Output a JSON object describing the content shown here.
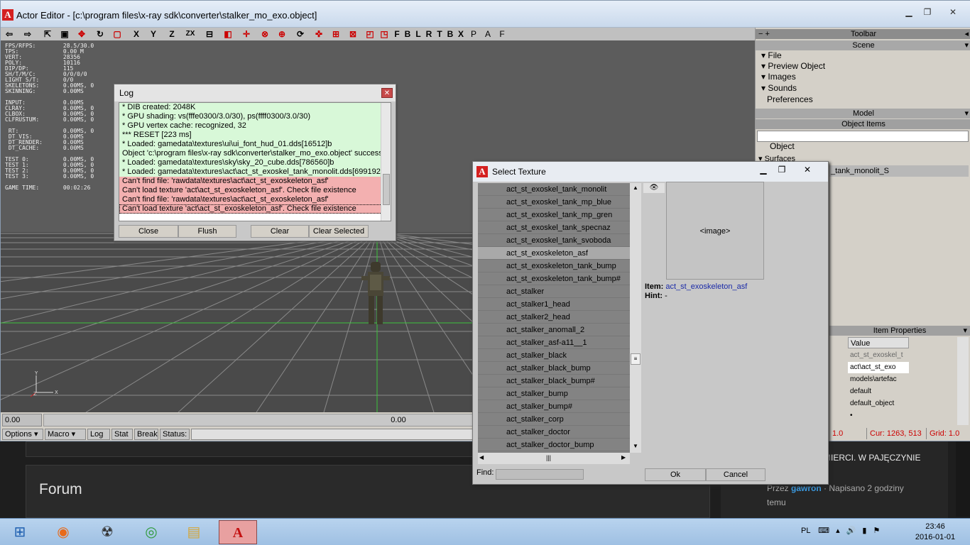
{
  "window": {
    "title": "Actor Editor - [c:\\program files\\x-ray sdk\\converter\\stalker_mo_exo.object]",
    "logo": "A"
  },
  "toolbar_letters": [
    "X",
    "Y",
    "Z",
    "ZX",
    "F",
    "B",
    "L",
    "R",
    "T",
    "B",
    "X",
    "P",
    "A",
    "F"
  ],
  "stats": "FPS/RFPS:        28.5/30.0\nTPS:             0.00 M\nVERT:            28356\nPOLY:            10116\nDIP/DP:          115\nSH/T/M/C:        0/0/0/0\nLIGHT S/T:       0/0\nSKELETONS:       0.00MS, 0\nSKINNING:        0.00MS\n\nINPUT:           0.00MS\nCLRAY:           0.00MS, 0\nCLBOX:           0.00MS, 0\nCLFRUSTUM:       0.00MS, 0\n\n RT:             0.00MS, 0\n DT_VIS:         0.00MS\n DT_RENDER:      0.00MS\n DT_CACHE:       0.00MS\n\nTEST 0:          0.00MS, 0\nTEST 1:          0.00MS, 0\nTEST 2:          0.00MS, 0\nTEST 3:          0.00MS, 0\n\nGAME TIME:       00:02:26",
  "bottombar": {
    "left_value": "0.00",
    "center_value": "0.00"
  },
  "statusbar": {
    "options": "Options",
    "macro": "Macro",
    "log": "Log",
    "stat": "Stat",
    "break": "Break",
    "status": "Status:",
    "coord1": "1.0",
    "cur": "Cur: 1263, 513",
    "grid": "Grid: 1.0"
  },
  "right_panel": {
    "toolbar_header": "Toolbar",
    "scene_header": "Scene",
    "scene_items": [
      "File",
      "Preview Object",
      "Images",
      "Sounds",
      "Preferences"
    ],
    "model_header": "Model",
    "object_items_header": "Object Items",
    "object_tree": [
      "Object",
      "Surfaces"
    ],
    "selected_surface": "_tank_monolit_S",
    "item_props_header": "Item Properties",
    "props_col_value": "Value",
    "props_values": [
      "act_st_exoskel_t",
      "act\\act_st_exo",
      "models\\artefac",
      "default",
      "default_object",
      "•",
      "...."
    ]
  },
  "log": {
    "title": "Log",
    "lines": [
      {
        "text": "* DIB created: 2048K",
        "type": "ok"
      },
      {
        "text": "* GPU shading: vs(fffe0300/3.0/30), ps(ffff0300/3.0/30)",
        "type": "ok"
      },
      {
        "text": "* GPU vertex cache: recognized, 32",
        "type": "ok"
      },
      {
        "text": "*** RESET [223 ms]",
        "type": "ok"
      },
      {
        "text": "* Loaded: gamedata\\textures\\ui\\ui_font_hud_01.dds[16512]b",
        "type": "ok"
      },
      {
        "text": "Object 'c:\\program files\\x-ray sdk\\converter\\stalker_mo_exo.object' success",
        "type": "ok"
      },
      {
        "text": "* Loaded: gamedata\\textures\\sky\\sky_20_cube.dds[786560]b",
        "type": "ok"
      },
      {
        "text": "* Loaded: gamedata\\textures\\act\\act_st_exoskel_tank_monolit.dds[699192",
        "type": "ok"
      },
      {
        "text": "Can't find file: 'rawdata\\textures\\act\\act_st_exoskeleton_asf'",
        "type": "err"
      },
      {
        "text": "Can't load texture 'act\\act_st_exoskeleton_asf'. Check file existence",
        "type": "err"
      },
      {
        "text": "Can't find file: 'rawdata\\textures\\act\\act_st_exoskeleton_asf'",
        "type": "err"
      },
      {
        "text": "Can't load texture 'act\\act_st_exoskeleton_asf'. Check file existence",
        "type": "err sel"
      }
    ],
    "buttons": {
      "close": "Close",
      "flush": "Flush",
      "clear": "Clear",
      "clear_selected": "Clear Selected"
    }
  },
  "select_texture": {
    "title": "Select Texture",
    "items": [
      "act_st_exoskel_tank_monolit",
      "act_st_exoskel_tank_mp_blue",
      "act_st_exoskel_tank_mp_gren",
      "act_st_exoskel_tank_specnaz",
      "act_st_exoskel_tank_svoboda",
      "act_st_exoskeleton_asf",
      "act_st_exoskeleton_tank_bump",
      "act_st_exoskeleton_tank_bump#",
      "act_stalker",
      "act_stalker1_head",
      "act_stalker2_head",
      "act_stalker_anomall_2",
      "act_stalker_asf-a11__1",
      "act_stalker_black",
      "act_stalker_black_bump",
      "act_stalker_black_bump#",
      "act_stalker_bump",
      "act_stalker_bump#",
      "act_stalker_corp",
      "act_stalker_doctor",
      "act_stalker_doctor_bump"
    ],
    "highlighted_index": 5,
    "image_placeholder": "<image>",
    "item_label": "Item:",
    "item_value": "act_st_exoskeleton_asf",
    "hint_label": "Hint:",
    "hint_value": "-",
    "find_label": "Find:",
    "ok": "Ok",
    "cancel": "Cancel"
  },
  "background_page": {
    "forum": "Forum",
    "post_title": "MIERCI. W PAJĘCZYNIE",
    "post_by": "Przez",
    "post_author": "gawron",
    "post_time": "· Napisano 2 godziny",
    "post_temu": "temu"
  },
  "taskbar": {
    "lang": "PL",
    "time": "23:46",
    "date": "2016-01-01"
  }
}
